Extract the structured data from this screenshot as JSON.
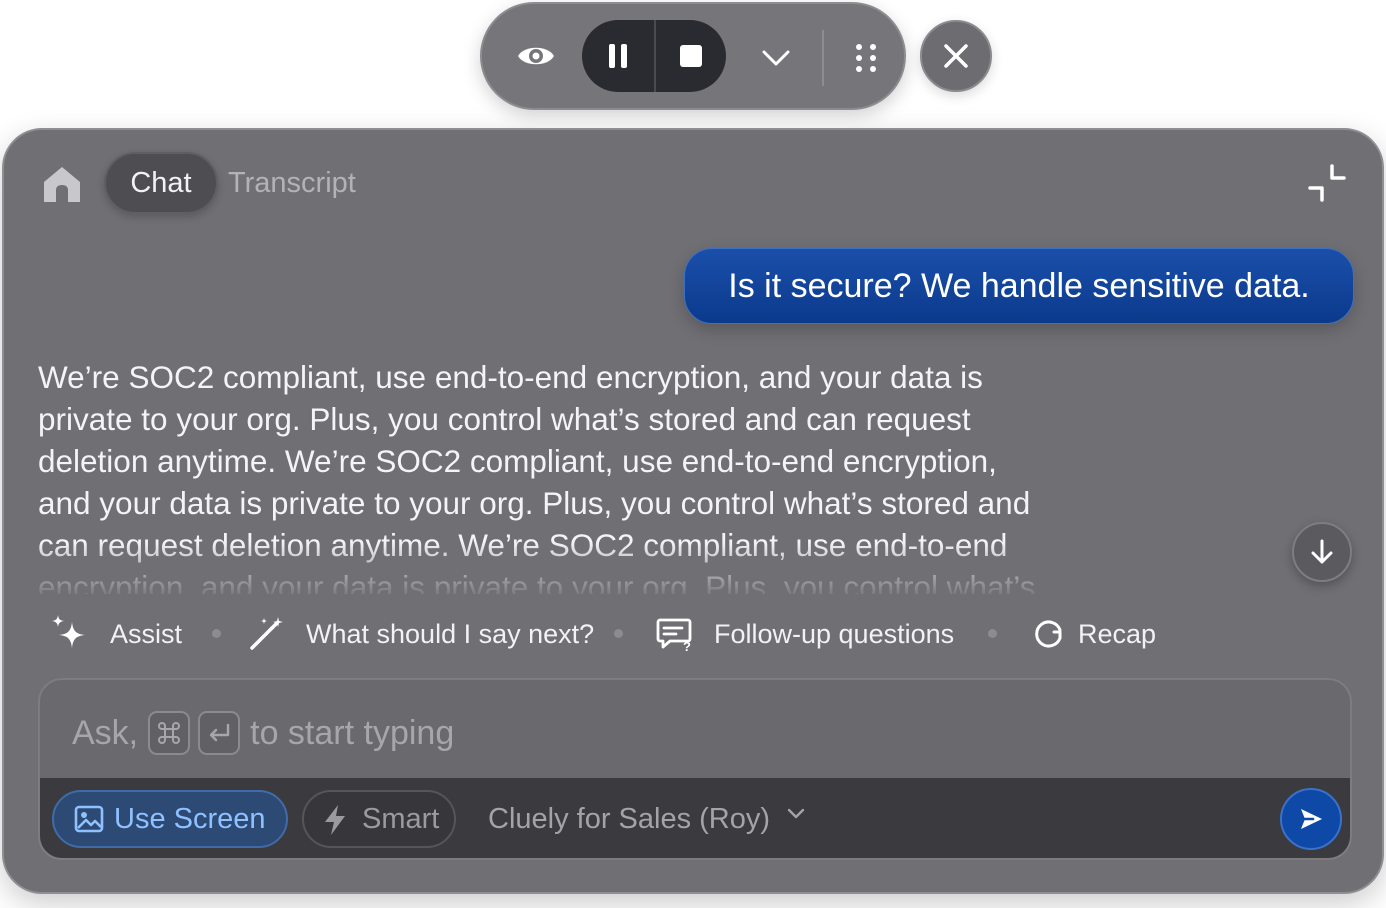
{
  "toolbar": {
    "icons": {
      "eye": "eye-icon",
      "pause": "pause-icon",
      "stop": "stop-icon",
      "chevron": "chevron-down-icon",
      "grip": "grip-dots-icon",
      "close": "close-icon"
    }
  },
  "header": {
    "tabs": [
      {
        "label": "Chat",
        "active": true
      },
      {
        "label": "Transcript",
        "active": false
      }
    ]
  },
  "conversation": {
    "user_message": "Is it secure? We handle sensitive data.",
    "assistant_lines": [
      "We’re SOC2 compliant, use end-to-end encryption, and your data is",
      "private to your org. Plus, you control what’s stored and can request",
      "deletion anytime. We’re SOC2 compliant, use end-to-end encryption,",
      "and your data is private to your org. Plus, you control what’s stored and",
      "can request deletion anytime. We’re SOC2 compliant, use end-to-end",
      "encryption, and your data is private to your org. Plus, you control what’s"
    ]
  },
  "actions": [
    {
      "label": "Assist",
      "icon": "sparkles-icon"
    },
    {
      "label": "What should I say next?",
      "icon": "magic-wand-icon"
    },
    {
      "label": "Follow-up questions",
      "icon": "chat-question-icon"
    },
    {
      "label": "Recap",
      "icon": "refresh-icon"
    }
  ],
  "composer": {
    "placeholder_prefix": "Ask,",
    "placeholder_suffix": "to start typing",
    "shortcut_keys": [
      "⌘",
      "↵"
    ],
    "use_screen_label": "Use Screen",
    "smart_label": "Smart",
    "model_label": "Cluely for Sales (Roy)"
  },
  "colors": {
    "panel": "#6f6f74",
    "user_bubble": "#0b3a8c",
    "send_button": "#0f49a8",
    "use_screen_text": "#8fc0ff"
  }
}
